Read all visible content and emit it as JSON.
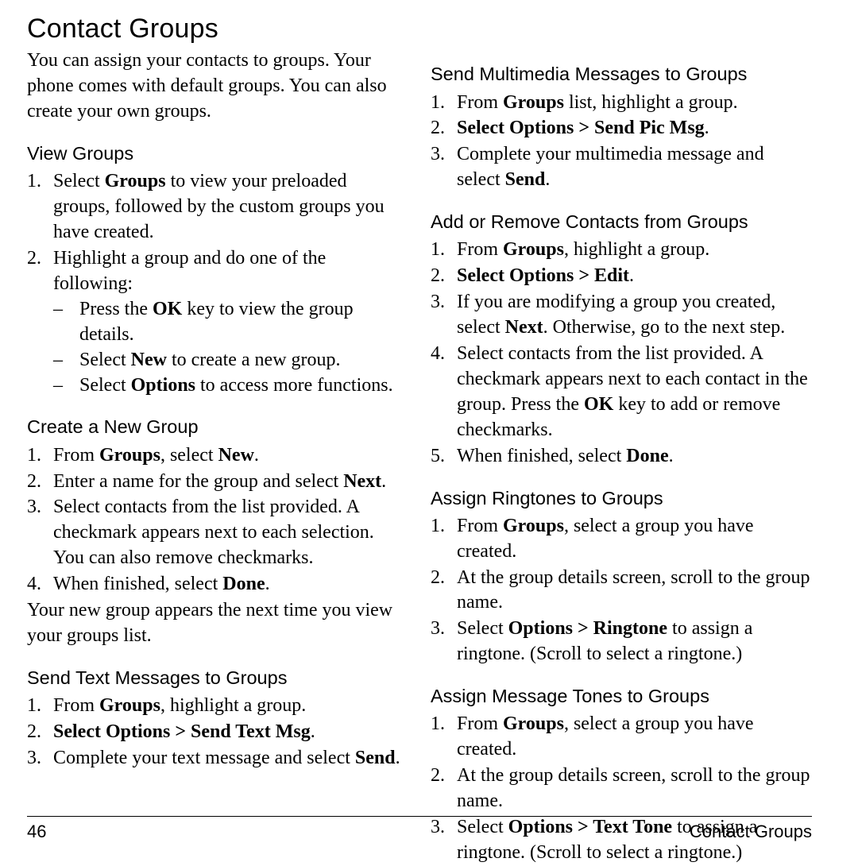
{
  "page": {
    "title": "Contact Groups",
    "footer_page_number": "46",
    "footer_section": "Contact Groups"
  },
  "left_column": {
    "intro": "You can assign your contacts to groups. Your phone comes with default groups. You can also create your own groups.",
    "sections": [
      {
        "heading": "View Groups",
        "steps": [
          {
            "num": "1.",
            "html": "Select <b>Groups</b> to view your preloaded groups, followed by the custom groups you have created."
          },
          {
            "num": "2.",
            "html": "Highlight a group and do one of the following:"
          }
        ],
        "substeps": [
          {
            "dash": "–",
            "html": "Press the <b>OK</b> key to view the group details."
          },
          {
            "dash": "–",
            "html": "Select <b>New</b> to create a new group."
          },
          {
            "dash": "–",
            "html": "Select <b>Options</b> to access more functions."
          }
        ]
      },
      {
        "heading": "Create a New Group",
        "steps": [
          {
            "num": "1.",
            "html": "From <b>Groups</b>, select <b>New</b>."
          },
          {
            "num": "2.",
            "html": "Enter a name for the group and select <b>Next</b>."
          },
          {
            "num": "3.",
            "html": "Select contacts from the list provided. A checkmark appears next to each selection. You can also remove checkmarks."
          },
          {
            "num": "4.",
            "html": "When finished, select <b>Done</b>."
          }
        ],
        "closing": "Your new group appears the next time you view your groups list."
      },
      {
        "heading": "Send Text Messages to Groups",
        "steps": [
          {
            "num": "1.",
            "html": "From <b>Groups</b>, highlight a group."
          },
          {
            "num": "2.",
            "html": "<b>Select Options &gt; Send Text Msg</b>."
          },
          {
            "num": "3.",
            "html": "Complete your text message and select <b>Send</b>."
          }
        ]
      }
    ]
  },
  "right_column": {
    "sections": [
      {
        "heading": "Send Multimedia Messages to Groups",
        "steps": [
          {
            "num": "1.",
            "html": "From <b>Groups</b> list, highlight a group."
          },
          {
            "num": "2.",
            "html": "<b>Select Options &gt; Send Pic Msg</b>."
          },
          {
            "num": "3.",
            "html": "Complete your multimedia message and select <b>Send</b>."
          }
        ]
      },
      {
        "heading": "Add or Remove Contacts from Groups",
        "steps": [
          {
            "num": "1.",
            "html": "From <b>Groups</b>, highlight a group."
          },
          {
            "num": "2.",
            "html": "<b>Select Options &gt; Edit</b>."
          },
          {
            "num": "3.",
            "html": "If you are modifying a group you created, select <b>Next</b>. Otherwise, go to the next step."
          },
          {
            "num": "4.",
            "html": "Select contacts from the list provided. A checkmark appears next to each contact in the group. Press the <b>OK</b> key to add or remove checkmarks."
          },
          {
            "num": "5.",
            "html": "When finished, select <b>Done</b>."
          }
        ]
      },
      {
        "heading": "Assign Ringtones to Groups",
        "steps": [
          {
            "num": "1.",
            "html": "From <b>Groups</b>, select a group you have created."
          },
          {
            "num": "2.",
            "html": "At the group details screen, scroll to the group name."
          },
          {
            "num": "3.",
            "html": "Select <b>Options &gt; Ringtone</b> to assign a ringtone. (Scroll to select a ringtone.)"
          }
        ]
      },
      {
        "heading": "Assign Message Tones to Groups",
        "steps": [
          {
            "num": "1.",
            "html": "From <b>Groups</b>, select a group you have created."
          },
          {
            "num": "2.",
            "html": "At the group details screen, scroll to the group name."
          },
          {
            "num": "3.",
            "html": "Select <b>Options &gt; Text Tone</b> to assign a ringtone. (Scroll to select a ringtone.)"
          }
        ]
      }
    ]
  }
}
